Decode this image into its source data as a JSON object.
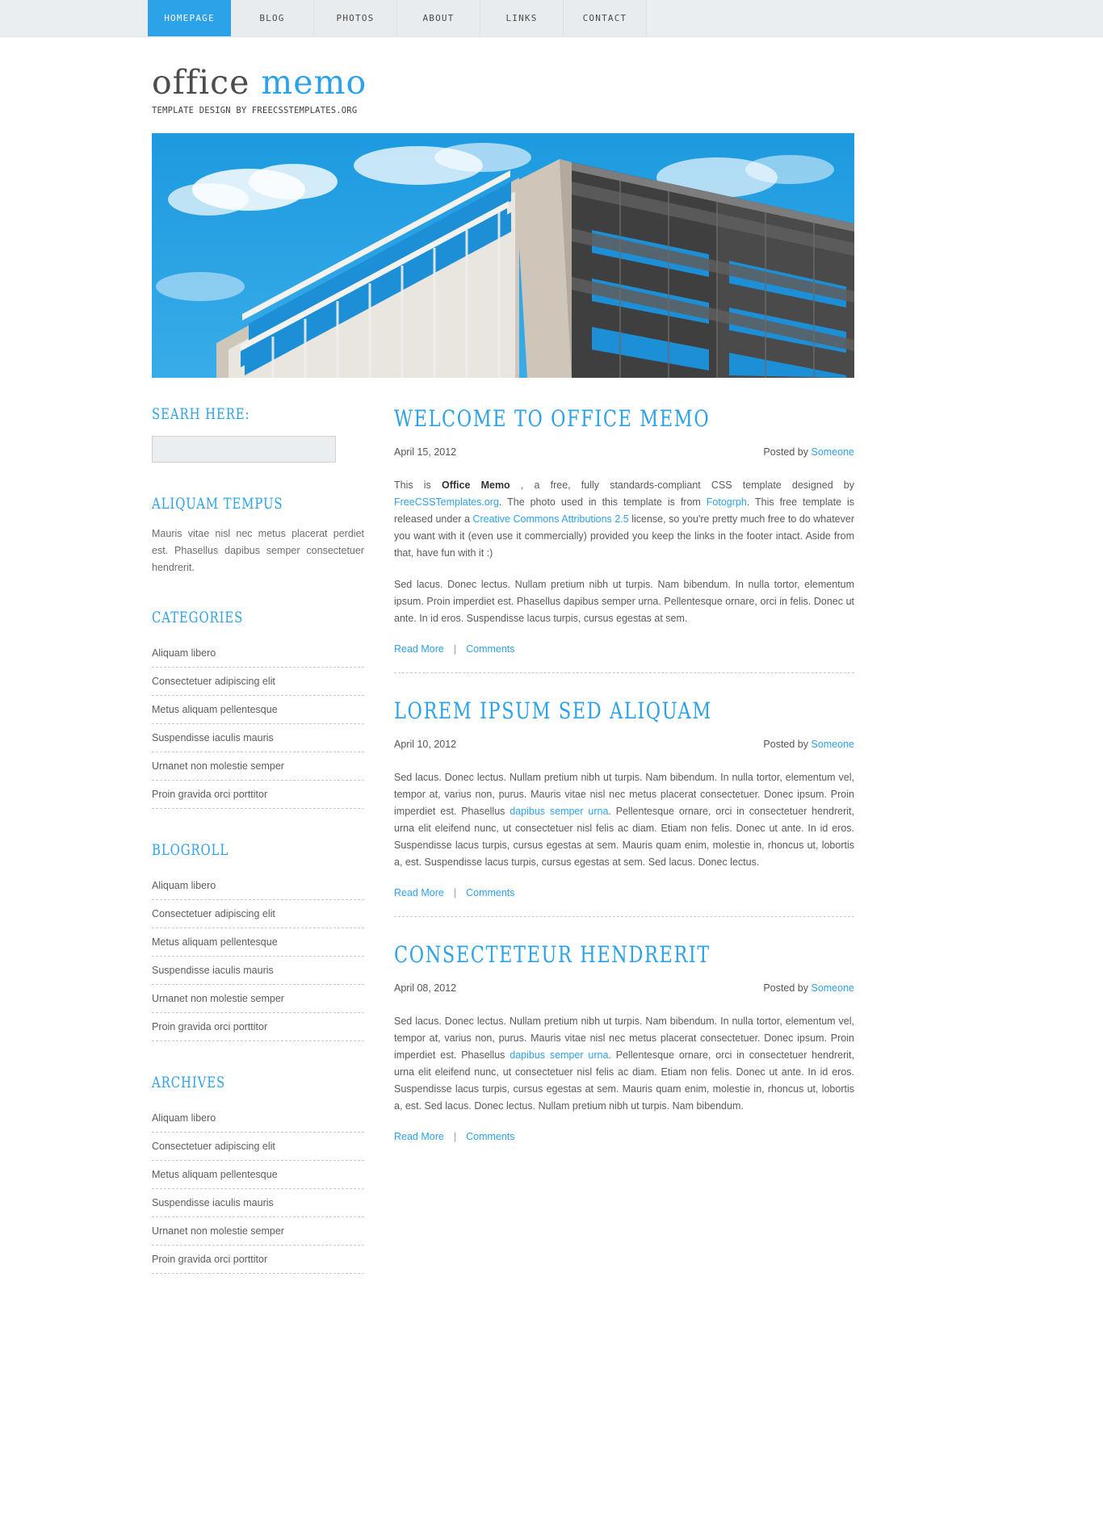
{
  "colors": {
    "accent": "#2ca2e8",
    "nav_bg": "#e9ecee",
    "body_text": "#5a5a5a"
  },
  "nav": {
    "items": [
      {
        "label": "Homepage",
        "active": true
      },
      {
        "label": "Blog",
        "active": false
      },
      {
        "label": "Photos",
        "active": false
      },
      {
        "label": "About",
        "active": false
      },
      {
        "label": "Links",
        "active": false
      },
      {
        "label": "Contact",
        "active": false
      }
    ]
  },
  "header": {
    "logo_primary": "office",
    "logo_accent": "memo",
    "tagline": "Template Design by FreeCSSTemplates.org"
  },
  "sidebar": {
    "search": {
      "heading": "Searh here:",
      "value": "",
      "placeholder": ""
    },
    "about": {
      "heading": "Aliquam Tempus",
      "text": "Mauris vitae nisl nec metus placerat perdiet est. Phasellus dapibus semper consectetuer hendrerit."
    },
    "categories": {
      "heading": "Categories",
      "items": [
        "Aliquam libero",
        "Consectetuer adipiscing elit",
        "Metus aliquam pellentesque",
        "Suspendisse iaculis mauris",
        "Urnanet non molestie semper",
        "Proin gravida orci porttitor"
      ]
    },
    "blogroll": {
      "heading": "Blogroll",
      "items": [
        "Aliquam libero",
        "Consectetuer adipiscing elit",
        "Metus aliquam pellentesque",
        "Suspendisse iaculis mauris",
        "Urnanet non molestie semper",
        "Proin gravida orci porttitor"
      ]
    },
    "archives": {
      "heading": "Archives",
      "items": [
        "Aliquam libero",
        "Consectetuer adipiscing elit",
        "Metus aliquam pellentesque",
        "Suspendisse iaculis mauris",
        "Urnanet non molestie semper",
        "Proin gravida orci porttitor"
      ]
    }
  },
  "posts": [
    {
      "title": "Welcome to Office Memo",
      "date": "April 15, 2012",
      "posted_by_label": "Posted by",
      "author": "Someone",
      "intro_pre": "This is ",
      "intro_strong": "Office Memo",
      "intro_post": " , a free, fully standards-compliant CSS template designed by ",
      "link1": "FreeCSSTemplates.org",
      "mid1": ". The photo used in this template is from ",
      "link2": "Fotogrph",
      "mid2": ". This free template is released under a ",
      "link3": "Creative Commons Attributions 2.5",
      "mid3": " license, so you're pretty much free to do whatever you want with it (even use it commercially) provided you keep the links in the footer intact. Aside from that, have fun with it :)",
      "paragraph2": "Sed lacus. Donec lectus. Nullam pretium nibh ut turpis. Nam bibendum. In nulla tortor, elementum ipsum. Proin imperdiet est. Phasellus dapibus semper urna. Pellentesque ornare, orci in felis. Donec ut ante. In id eros. Suspendisse lacus turpis, cursus egestas at sem.",
      "read_more": "Read More",
      "separator": "|",
      "comments": "Comments"
    },
    {
      "title": "Lorem Ipsum Sed Aliquam",
      "date": "April 10, 2012",
      "posted_by_label": "Posted by",
      "author": "Someone",
      "body_pre": "Sed lacus. Donec lectus. Nullam pretium nibh ut turpis. Nam bibendum. In nulla tortor, elementum vel, tempor at, varius non, purus. Mauris vitae nisl nec metus placerat consectetuer. Donec ipsum. Proin imperdiet est. Phasellus ",
      "body_link": "dapibus semper urna",
      "body_post": ". Pellentesque ornare, orci in consectetuer hendrerit, urna elit eleifend nunc, ut consectetuer nisl felis ac diam. Etiam non felis. Donec ut ante. In id eros. Suspendisse lacus turpis, cursus egestas at sem. Mauris quam enim, molestie in, rhoncus ut, lobortis a, est. Suspendisse lacus turpis, cursus egestas at sem. Sed lacus. Donec lectus.",
      "read_more": "Read More",
      "separator": "|",
      "comments": "Comments"
    },
    {
      "title": "Consecteteur Hendrerit",
      "date": "April 08, 2012",
      "posted_by_label": "Posted by",
      "author": "Someone",
      "body_pre": "Sed lacus. Donec lectus. Nullam pretium nibh ut turpis. Nam bibendum. In nulla tortor, elementum vel, tempor at, varius non, purus. Mauris vitae nisl nec metus placerat consectetuer. Donec ipsum. Proin imperdiet est. Phasellus ",
      "body_link": "dapibus semper urna",
      "body_post": ". Pellentesque ornare, orci in consectetuer hendrerit, urna elit eleifend nunc, ut consectetuer nisl felis ac diam. Etiam non felis. Donec ut ante. In id eros. Suspendisse lacus turpis, cursus egestas at sem. Mauris quam enim, molestie in, rhoncus ut, lobortis a, est. Sed lacus. Donec lectus. Nullam pretium nibh ut turpis. Nam bibendum.",
      "read_more": "Read More",
      "separator": "|",
      "comments": "Comments"
    }
  ],
  "banner": {
    "alt": "office-building-photo"
  }
}
